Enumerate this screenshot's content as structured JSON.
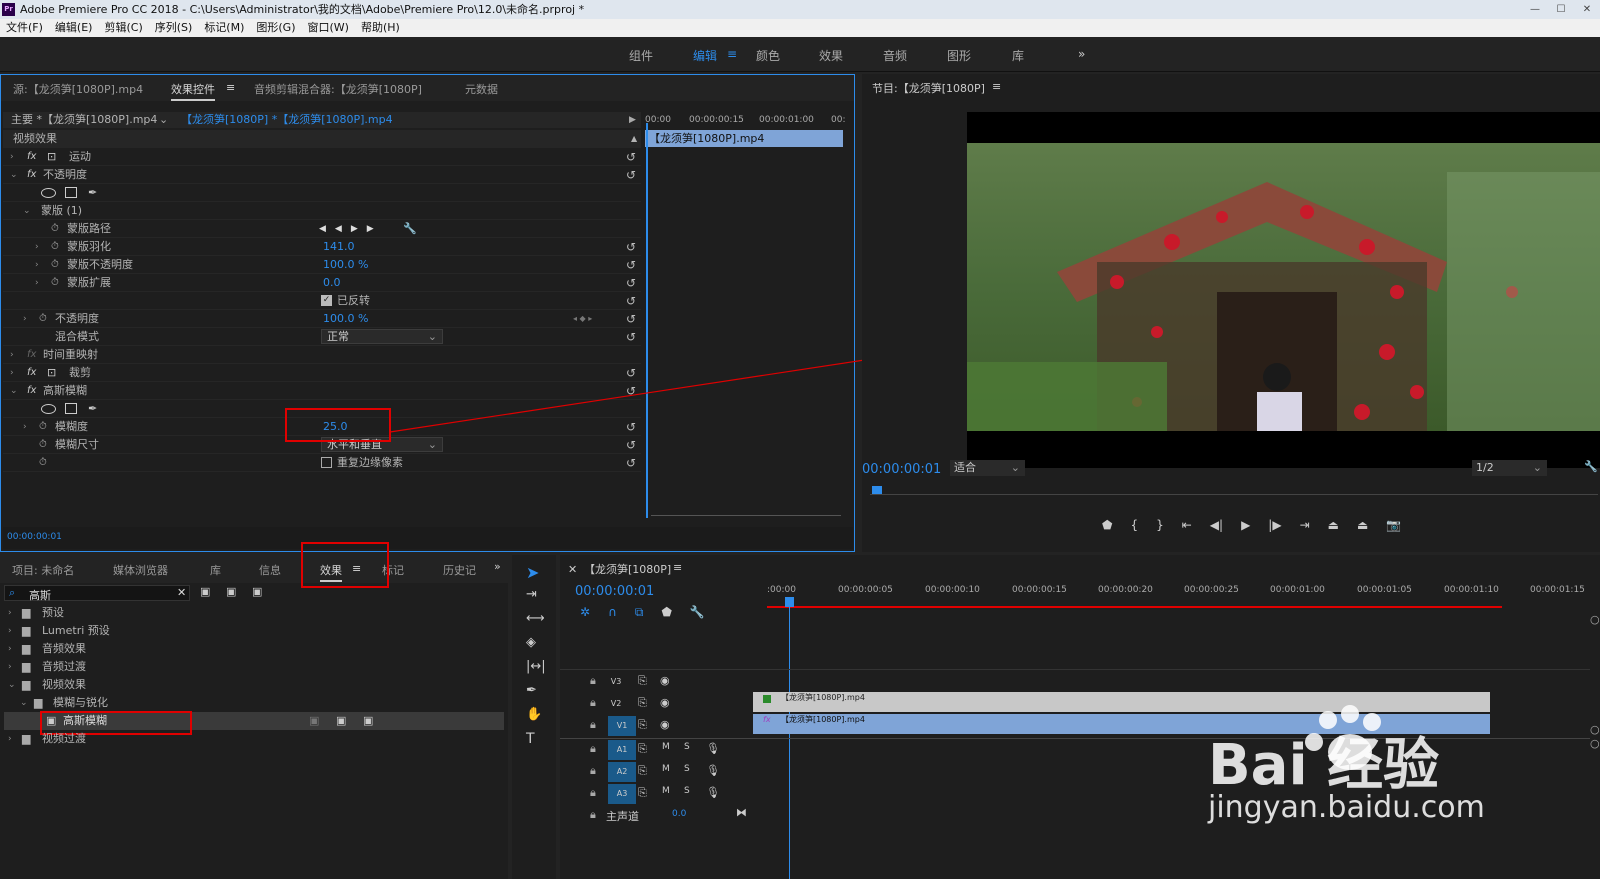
{
  "window": {
    "title": "Adobe Premiere Pro CC 2018 - C:\\Users\\Administrator\\我的文档\\Adobe\\Premiere Pro\\12.0\\未命名.prproj *",
    "app_icon": "Pr"
  },
  "menu": [
    "文件(F)",
    "编辑(E)",
    "剪辑(C)",
    "序列(S)",
    "标记(M)",
    "图形(G)",
    "窗口(W)",
    "帮助(H)"
  ],
  "workspaces": [
    {
      "label": "组件",
      "active": false
    },
    {
      "label": "编辑",
      "active": true
    },
    {
      "label": "颜色",
      "active": false
    },
    {
      "label": "效果",
      "active": false
    },
    {
      "label": "音频",
      "active": false
    },
    {
      "label": "图形",
      "active": false
    },
    {
      "label": "库",
      "active": false
    }
  ],
  "workspace_more": "»",
  "effect_controls": {
    "tabs": {
      "source": "源:【龙须笋[1080P].mp4",
      "effect_controls": "效果控件",
      "audio_mixer": "音频剪辑混合器:【龙须笋[1080P]",
      "metadata": "元数据"
    },
    "master_clip": "主要 *【龙须笋[1080P].mp4",
    "sequence_clip": "【龙须笋[1080P] *【龙须笋[1080P].mp4",
    "ruler": [
      "00:00",
      "00:00:00:15",
      "00:00:01:00",
      "00:"
    ],
    "clip_bar": "【龙须笋[1080P].mp4",
    "section": "视频效果",
    "motion": "运动",
    "opacity": "不透明度",
    "mask": "蒙版 (1)",
    "mask_path": "蒙版路径",
    "mask_feather": "蒙版羽化",
    "mask_feather_value": "141.0",
    "mask_opacity": "蒙版不透明度",
    "mask_opacity_value": "100.0 %",
    "mask_expansion": "蒙版扩展",
    "mask_expansion_value": "0.0",
    "inverted": "已反转",
    "opacity_prop": "不透明度",
    "opacity_value": "100.0 %",
    "blend_mode": "混合模式",
    "blend_mode_value": "正常",
    "time_remap": "时间重映射",
    "crop": "裁剪",
    "gaussian_blur": "高斯模糊",
    "blurriness": "模糊度",
    "blurriness_value": "25.0",
    "blur_dimensions": "模糊尺寸",
    "blur_dimensions_value": "水平和垂直",
    "repeat_edge": "重复边缘像素",
    "timecode": "00:00:00:01"
  },
  "program": {
    "title": "节目:【龙须笋[1080P]",
    "timecode": "00:00:00:01",
    "fit": "适合",
    "resolution": "1/2"
  },
  "project": {
    "tabs": [
      "项目: 未命名",
      "媒体浏览器",
      "库",
      "信息",
      "效果",
      "标记",
      "历史记"
    ],
    "active_tab": "效果",
    "search_value": "高斯",
    "tree": [
      {
        "label": "预设",
        "level": 0
      },
      {
        "label": "Lumetri 预设",
        "level": 0
      },
      {
        "label": "音频效果",
        "level": 0
      },
      {
        "label": "音频过渡",
        "level": 0
      },
      {
        "label": "视频效果",
        "level": 0
      },
      {
        "label": "模糊与锐化",
        "level": 1
      },
      {
        "label": "高斯模糊",
        "level": 2
      },
      {
        "label": "视频过渡",
        "level": 0
      }
    ]
  },
  "timeline": {
    "title": "【龙须笋[1080P]",
    "timecode": "00:00:00:01",
    "ruler": [
      ":00:00",
      "00:00:00:05",
      "00:00:00:10",
      "00:00:00:15",
      "00:00:00:20",
      "00:00:00:25",
      "00:00:01:00",
      "00:00:01:05",
      "00:00:01:10",
      "00:00:01:15"
    ],
    "video_tracks": [
      "V3",
      "V2",
      "V1"
    ],
    "audio_tracks": [
      "A1",
      "A2",
      "A3"
    ],
    "master": "主声道",
    "master_value": "0.0",
    "clip_v2": "【龙须笋[1080P].mp4",
    "clip_v1": "【龙须笋[1080P].mp4",
    "m": "M",
    "s": "S"
  },
  "watermark": {
    "brand": "Bai 经验",
    "url": "jingyan.baidu.com"
  },
  "colors": {
    "accent": "#2d8ceb",
    "highlight_box": "#e00000",
    "clip_v1": "#7fa4d7",
    "clip_v2": "#c8c8c8"
  }
}
